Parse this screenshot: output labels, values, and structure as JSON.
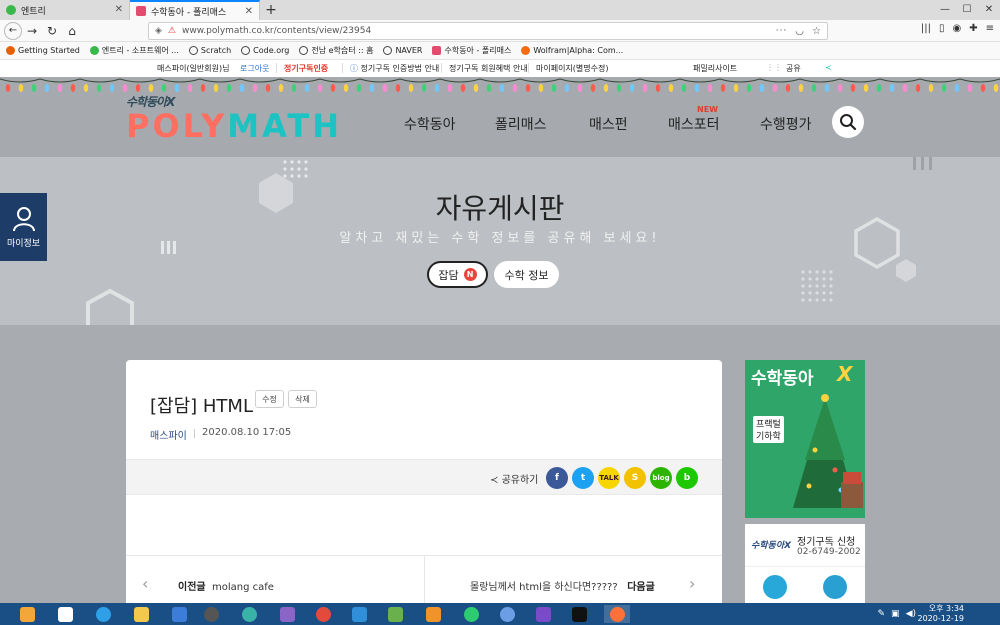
{
  "browser": {
    "tabs": [
      {
        "title": "엔트리",
        "favicon_color": "#3bb84a",
        "active": false
      },
      {
        "title": "수학동아 - 폴리매스",
        "favicon_color": "#e34c6e",
        "active": true
      }
    ],
    "url": "www.polymath.co.kr/contents/view/23954",
    "bookmarks": [
      {
        "label": "Getting Started",
        "color": "#e66000"
      },
      {
        "label": "엔트리 - 소프트웨어 ...",
        "color": "#3bb84a"
      },
      {
        "label": "Scratch",
        "color": "#444444"
      },
      {
        "label": "Code.org",
        "color": "#444444"
      },
      {
        "label": "전남 e학습터 :: 홈",
        "color": "#444444"
      },
      {
        "label": "NAVER",
        "color": "#444444"
      },
      {
        "label": "수학동아 - 폴리매스",
        "color": "#e34c6e"
      },
      {
        "label": "Wolfram|Alpha: Com...",
        "color": "#f36b12"
      }
    ]
  },
  "utilbar": {
    "user": "매스파이(일반회원)님",
    "logout": "로그아웃",
    "subscribe_auth": "정기구독인증",
    "auth_guide": "정기구독 인증방법 안내",
    "benefits": "정기구독 회원혜택 안내",
    "mypage": "마이페이지(별명수정)",
    "family": "패밀리사이트",
    "share": "공유"
  },
  "header": {
    "logo_small": "수학동아X",
    "logo_poly": "POLY",
    "logo_math": "MATH",
    "nav": [
      "수학동아",
      "폴리매스",
      "매스펀",
      "매스포터",
      "수행평가"
    ],
    "new_badge": "NEW"
  },
  "sidebar": {
    "mypage_label": "마이정보"
  },
  "banner": {
    "title": "자유게시판",
    "subtitle": "알차고 재밌는 수학 정보를 공유해 보세요!",
    "tabs": [
      {
        "label": "잡담",
        "badge": "N"
      },
      {
        "label": "수학 정보",
        "badge": ""
      }
    ]
  },
  "post": {
    "title": "[잡담] HTML",
    "edit_label": "수정",
    "delete_label": "삭제",
    "author": "매스파이",
    "date": "2020.08.10 17:05",
    "share_label": "공유하기",
    "share_icons": [
      {
        "name": "facebook-icon",
        "color": "#3b5998",
        "glyph": "f"
      },
      {
        "name": "twitter-icon",
        "color": "#1da1f2",
        "glyph": "t"
      },
      {
        "name": "kakaotalk-icon",
        "color": "#f7d600",
        "glyph": "TALK"
      },
      {
        "name": "kakaostory-icon",
        "color": "#f2c200",
        "glyph": "S"
      },
      {
        "name": "naver-blog-icon",
        "color": "#2db400",
        "glyph": "blog"
      },
      {
        "name": "band-icon",
        "color": "#1ec800",
        "glyph": "b"
      }
    ],
    "prev_label": "이전글",
    "prev_title": "molang cafe",
    "next_title": "몰랑님께서 html을 하신다면?????",
    "next_label": "다음글"
  },
  "side": {
    "ad_title": "수학동아",
    "ad_x": "X",
    "ad_line1": "프랙털",
    "ad_line2": "기하학",
    "subscribe_brand": "수학동아X",
    "subscribe_label": "정기구독 신청",
    "phone": "02-6749-2002"
  },
  "taskbar": {
    "time": "오후 3:34",
    "date": "2020-12-19"
  }
}
